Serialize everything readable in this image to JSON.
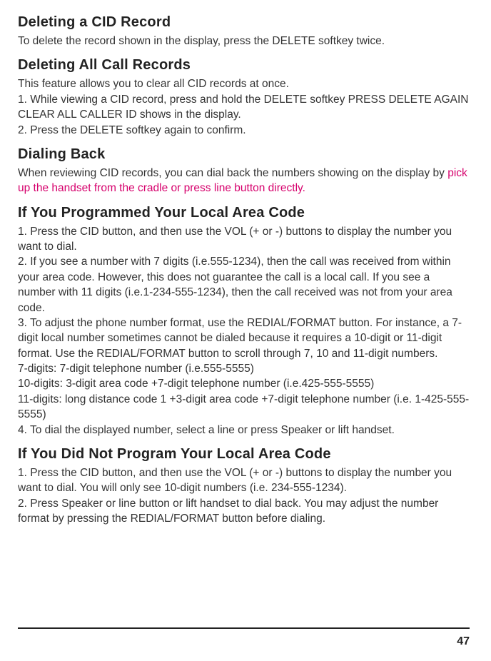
{
  "sections": {
    "s1": {
      "heading": "Deleting a CID Record",
      "body": " To delete the record shown in the display, press the DELETE softkey twice."
    },
    "s2": {
      "heading": "Deleting All Call Records",
      "body1": "This feature allows you to clear all CID records at once.",
      "body2": "1. While viewing a CID record, press and hold the DELETE softkey PRESS DELETE AGAIN CLEAR ALL CALLER ID shows in the display.",
      "body3": "2. Press the DELETE softkey again to confirm."
    },
    "s3": {
      "heading": "Dialing Back",
      "body1": "When reviewing CID records, you can dial back the numbers showing on the display by ",
      "body2_pink": "pick up the handset from the cradle or press line button directly."
    },
    "s4": {
      "heading": "If You Programmed Your Local Area Code",
      "body1": "1. Press the CID button, and then use the VOL (+ or -) buttons to display the number you want to dial.",
      "body2": "2. If you see a number with 7 digits (i.e.555-1234), then the call was received from within your area code. However, this does not guarantee the call is a local call. If you see a number with 11 digits (i.e.1-234-555-1234), then the call received was not from your area code.",
      "body3": "3. To adjust the phone number format, use the REDIAL/FORMAT button. For instance, a 7-digit local number sometimes cannot be dialed because it requires a 10-digit or 11-digit format. Use the REDIAL/FORMAT button to scroll through 7, 10 and 11-digit numbers.",
      "body4": "7-digits: 7-digit telephone number (i.e.555-5555)",
      "body5": "10-digits: 3-digit area code +7-digit telephone number (i.e.425-555-5555)",
      "body6": "11-digits: long distance code 1 +3-digit area code +7-digit telephone number (i.e. 1-425-555-5555)",
      "body7": "4. To dial the displayed number, select a line or press Speaker or lift handset."
    },
    "s5": {
      "heading": "If You Did Not Program Your Local Area Code",
      "body1": "1. Press the CID button, and then use the VOL (+ or -) buttons to display the number you want to dial. You will only see 10-digit numbers (i.e. 234-555-1234).",
      "body2": "2. Press Speaker or line button or lift handset to dial back. You may adjust the number format by pressing the REDIAL/FORMAT button before dialing."
    }
  },
  "page_number": "47"
}
